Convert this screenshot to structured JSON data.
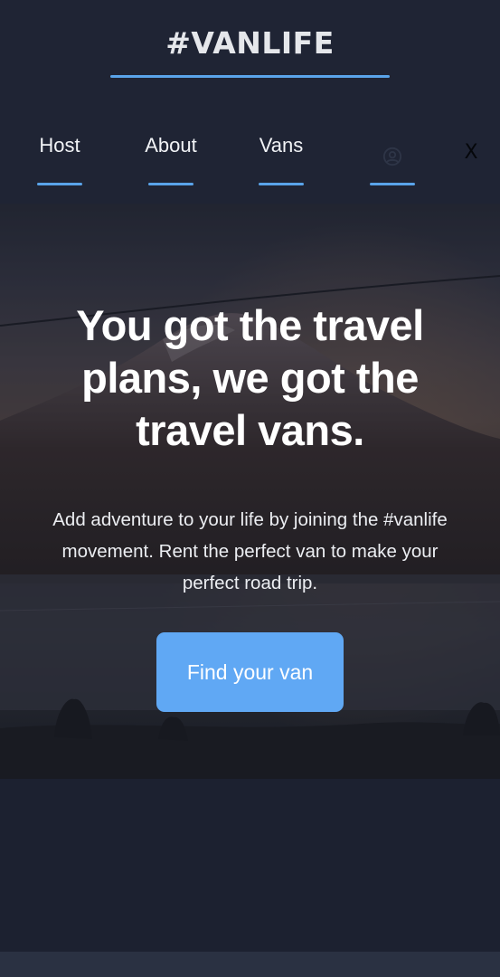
{
  "header": {
    "logo": "#VANLIFE",
    "nav": [
      {
        "label": "Host"
      },
      {
        "label": "About"
      },
      {
        "label": "Vans"
      },
      {
        "label": "",
        "icon": "user-circle-icon"
      }
    ],
    "close_label": "X"
  },
  "hero": {
    "title": "You got the travel plans, we got the travel vans.",
    "description": "Add adventure to your life by joining the #vanlife movement. Rent the perfect van to make your perfect road trip.",
    "cta_label": "Find your van"
  },
  "colors": {
    "accent": "#5aa4ea",
    "button": "#60a8f4",
    "background": "#1c2130",
    "header": "#1f2434"
  }
}
